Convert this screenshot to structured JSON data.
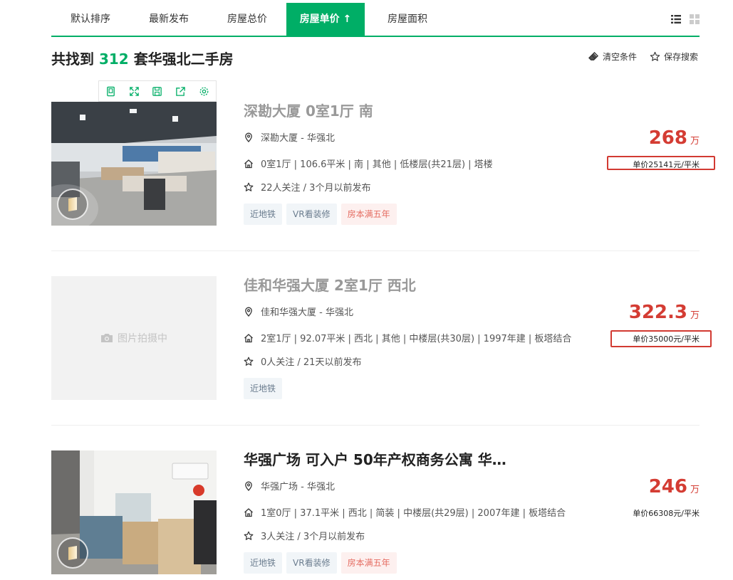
{
  "sort_tabs": [
    {
      "label": "默认排序"
    },
    {
      "label": "最新发布"
    },
    {
      "label": "房屋总价"
    },
    {
      "label": "房屋单价 ↑"
    },
    {
      "label": "房屋面积"
    }
  ],
  "active_tab_index": 3,
  "result": {
    "prefix": "共找到",
    "count": "312",
    "suffix": "套华强北二手房"
  },
  "actions": {
    "clear": "清空条件",
    "save": "保存搜索"
  },
  "listings": [
    {
      "title": "深勘大厦 0室1厅 南",
      "position": "深勘大厦 - 华强北",
      "house_info": "0室1厅 | 106.6平米 | 南 | 其他 | 低楼层(共21层) | 塔楼",
      "follow_info": "22人关注 / 3个月以前发布",
      "tags": [
        "近地铁",
        "VR看装修",
        "房本满五年"
      ],
      "total_price": "268",
      "price_unit": "万",
      "unit_price": "单价25141元/平米"
    },
    {
      "title": "佳和华强大厦 2室1厅 西北",
      "position": "佳和华强大厦 - 华强北",
      "house_info": "2室1厅 | 92.07平米 | 西北 | 其他 | 中楼层(共30层) | 1997年建 | 板塔结合",
      "follow_info": "0人关注 / 21天以前发布",
      "tags": [
        "近地铁"
      ],
      "placeholder": "图片拍摄中",
      "total_price": "322.3",
      "price_unit": "万",
      "unit_price": "单价35000元/平米"
    },
    {
      "title": "华强广场 可入户 50年产权商务公寓 华…",
      "position": "华强广场 - 华强北",
      "house_info": "1室0厅 | 37.1平米 | 西北 | 简装 | 中楼层(共29层) | 2007年建 | 板塔结合",
      "follow_info": "3人关注 / 3个月以前发布",
      "tags": [
        "近地铁",
        "VR看装修",
        "房本满五年"
      ],
      "total_price": "246",
      "price_unit": "万",
      "unit_price": "单价66308元/平米"
    }
  ],
  "colors": {
    "brand_green": "#00ae66",
    "price_red": "#d43c33",
    "highlight_red": "#d23a32"
  }
}
